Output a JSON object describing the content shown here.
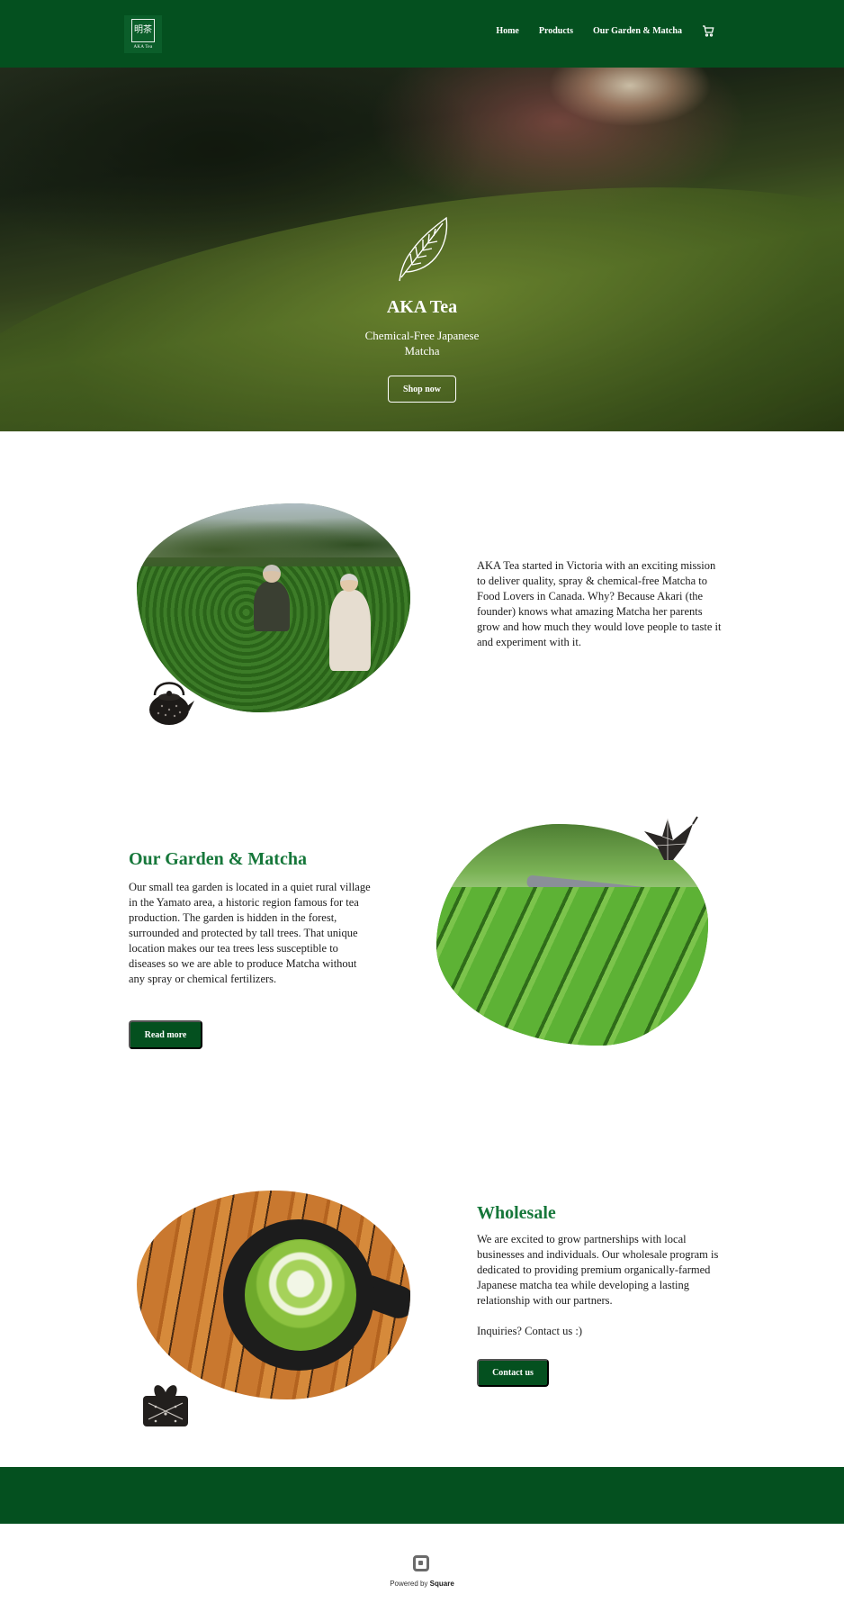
{
  "header": {
    "logo_glyph": "明茶",
    "logo_text": "AKA Tea",
    "nav": [
      "Home",
      "Products",
      "Our Garden & Matcha"
    ],
    "cart_icon": "cart-icon"
  },
  "hero": {
    "icon": "leaf-icon",
    "title": "AKA Tea",
    "subtitle": "Chemical-Free Japanese Matcha",
    "button": "Shop now"
  },
  "about": {
    "text": "AKA Tea started in Victoria with an exciting mission to deliver quality, spray & chemical-free Matcha to Food Lovers in Canada. Why? Because Akari (the founder) knows what amazing Matcha her parents grow and how much they would love people to taste it and experiment with it.",
    "decor_icon": "teapot-icon"
  },
  "garden": {
    "title": "Our Garden & Matcha",
    "text": "Our small tea garden is located in a quiet rural village in the Yamato area, a historic region famous for tea production. The garden is hidden in the forest, surrounded and protected by tall trees. That unique location makes our tea trees less susceptible to diseases so we are able to produce Matcha without any spray or chemical fertilizers.",
    "button": "Read more",
    "decor_icon": "origami-crane-icon"
  },
  "wholesale": {
    "title": "Wholesale",
    "text": "We are excited to grow partnerships with local businesses and individuals. Our wholesale program is dedicated to providing premium organically-farmed Japanese matcha tea while developing a lasting relationship with our partners.",
    "inquiry": "Inquiries? Contact us :)",
    "button": "Contact us",
    "decor_icon": "furoshiki-icon"
  },
  "footer": {
    "powered_prefix": "Powered by",
    "powered_brand": "Square",
    "brand_icon": "square-logo-icon"
  },
  "colors": {
    "brand_green": "#04501f",
    "heading_green": "#16773a",
    "text": "#1b1b1b"
  }
}
